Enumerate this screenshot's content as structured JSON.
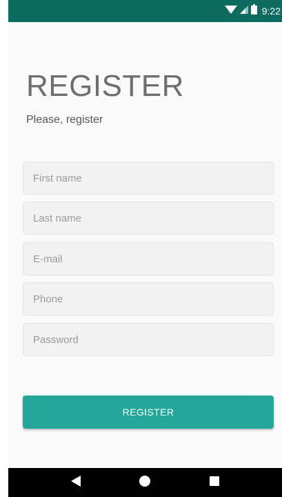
{
  "status_bar": {
    "time": "9:22",
    "icons": [
      "wifi-icon",
      "cell-signal-icon",
      "battery-icon"
    ],
    "background": "#0e6b5d"
  },
  "header": {
    "title": "REGISTER",
    "subtitle": "Please, register"
  },
  "form": {
    "first_name": {
      "placeholder": "First name",
      "value": ""
    },
    "last_name": {
      "placeholder": "Last name",
      "value": ""
    },
    "email": {
      "placeholder": "E-mail",
      "value": ""
    },
    "phone": {
      "placeholder": "Phone",
      "value": ""
    },
    "password": {
      "placeholder": "Password",
      "value": ""
    }
  },
  "actions": {
    "register_label": "REGISTER",
    "accent": "#26a69a"
  },
  "nav_bar": {
    "buttons": [
      "back-icon",
      "home-icon",
      "recents-icon"
    ]
  }
}
